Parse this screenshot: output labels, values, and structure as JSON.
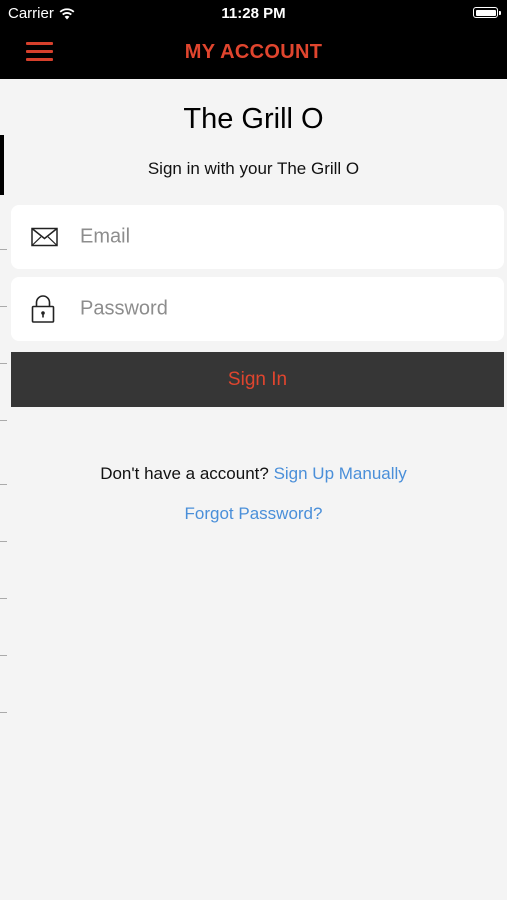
{
  "status_bar": {
    "carrier": "Carrier",
    "time": "11:28 PM"
  },
  "nav": {
    "title": "MY ACCOUNT",
    "accent_color": "#e0452e"
  },
  "header": {
    "title": "The Grill O",
    "subtitle": "Sign in with your The Grill O"
  },
  "form": {
    "email_placeholder": "Email",
    "password_placeholder": "Password",
    "signin_label": "Sign In"
  },
  "footer": {
    "signup_prompt": "Don't have a account?",
    "signup_link": "Sign Up Manually",
    "forgot_link": "Forgot Password?"
  },
  "icons": {
    "menu": "hamburger-menu-icon",
    "email": "envelope-icon",
    "password": "lock-icon"
  }
}
